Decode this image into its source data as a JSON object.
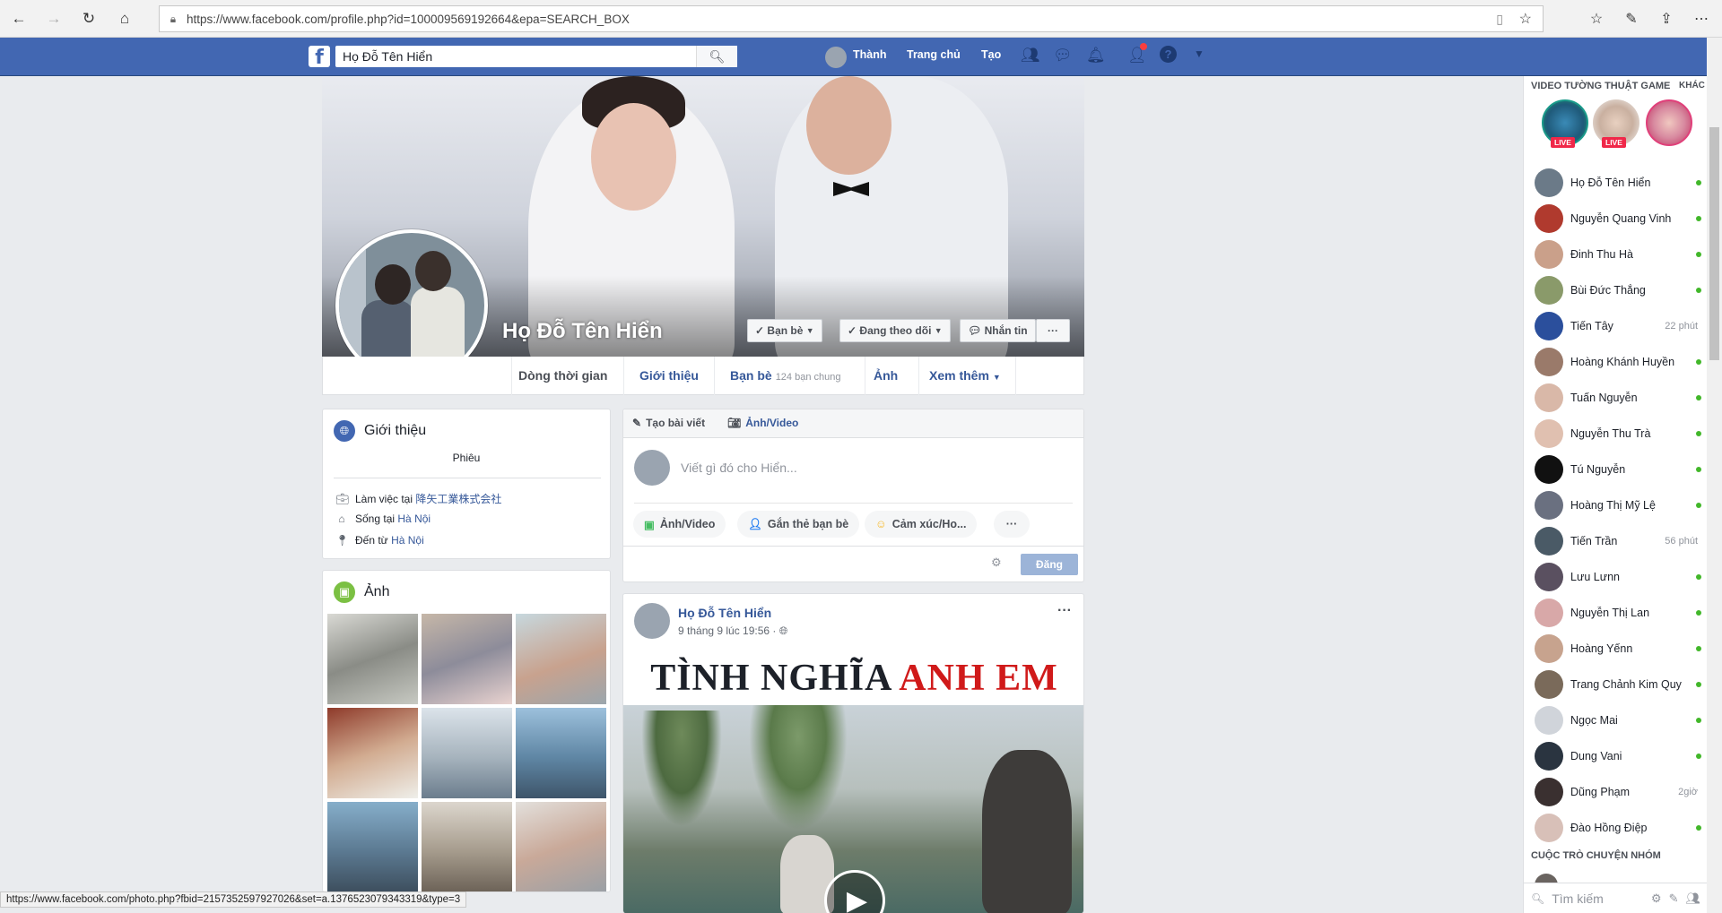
{
  "browser": {
    "url": "https://www.facebook.com/profile.php?id=100009569192664&epa=SEARCH_BOX"
  },
  "fb": {
    "search_value": "Họ Đỗ Tên Hiển",
    "nav_user": "Thành",
    "nav_home": "Trang chủ",
    "nav_create": "Tạo"
  },
  "profile": {
    "name": "Họ Đỗ Tên Hiển",
    "btn_friends": "Bạn bè",
    "btn_following": "Đang theo dõi",
    "btn_message": "Nhắn tin",
    "btn_more": "···",
    "tabs": [
      {
        "label": "Dòng thời gian"
      },
      {
        "label": "Giới thiệu"
      },
      {
        "label": "Bạn bè",
        "sub": "124 bạn chung"
      },
      {
        "label": "Ảnh"
      },
      {
        "label": "Xem thêm"
      }
    ]
  },
  "intro": {
    "title": "Giới thiệu",
    "bio": "Phiêu",
    "work_prefix": "Làm việc tại",
    "work_link": "降矢工業株式会社",
    "live_prefix": "Sống tại",
    "live_link": "Hà Nội",
    "from_prefix": "Đến từ",
    "from_link": "Hà Nội"
  },
  "photos": {
    "title": "Ảnh"
  },
  "composer": {
    "tab_create": "Tạo bài viết",
    "tab_media": "Ảnh/Video",
    "placeholder": "Viết gì đó cho Hiển...",
    "pill_media": "Ảnh/Video",
    "pill_tag": "Gắn thẻ bạn bè",
    "pill_feeling": "Cảm xúc/Ho...",
    "pill_more": "···",
    "post_button": "Đăng"
  },
  "post": {
    "author": "Họ Đỗ Tên Hiển",
    "time": "9 tháng 9 lúc 19:56 ·",
    "menu": "···",
    "video_title_black": "TÌNH NGHĨA",
    "video_title_red": "ANH EM"
  },
  "sidebar": {
    "video_header": "VIDEO TƯỜNG THUẬT GAME",
    "video_more": "KHÁC",
    "live_label": "LIVE",
    "group_header": "CUỘC TRÒ CHUYỆN NHÓM",
    "search_placeholder": "Tìm kiếm",
    "contacts": [
      {
        "name": "Họ Đỗ Tên Hiển",
        "status": "",
        "color": "#6b7a88"
      },
      {
        "name": "Nguyễn Quang Vinh",
        "status": "",
        "color": "#b03a2e"
      },
      {
        "name": "Đinh Thu Hà",
        "status": "",
        "color": "#caa08a"
      },
      {
        "name": "Bùi Đức Thắng",
        "status": "",
        "color": "#8a9a6a"
      },
      {
        "name": "Tiến Tây",
        "status": "22 phút",
        "color": "#2b4f9c"
      },
      {
        "name": "Hoàng Khánh Huyền",
        "status": "",
        "color": "#9a7a6a"
      },
      {
        "name": "Tuấn Nguyễn",
        "status": "",
        "color": "#d9b8a8"
      },
      {
        "name": "Nguyễn Thu Trà",
        "status": "",
        "color": "#e0c0b0"
      },
      {
        "name": "Tú Nguyễn",
        "status": "",
        "color": "#111111"
      },
      {
        "name": "Hoàng Thị Mỹ Lệ",
        "status": "",
        "color": "#6a7080"
      },
      {
        "name": "Tiến Trần",
        "status": "56 phút",
        "color": "#4a5a66"
      },
      {
        "name": "Lưu Lưnn",
        "status": "",
        "color": "#5a5060"
      },
      {
        "name": "Nguyễn Thị Lan",
        "status": "",
        "color": "#d8a8a8"
      },
      {
        "name": "Hoàng Yếnn",
        "status": "",
        "color": "#c7a38e"
      },
      {
        "name": "Trang Chảnh Kim Quy",
        "status": "",
        "color": "#7a6a5a"
      },
      {
        "name": "Ngọc Mai",
        "status": "",
        "color": "#d0d4da"
      },
      {
        "name": "Dung Vani",
        "status": "",
        "color": "#2a3440"
      },
      {
        "name": "Dũng Phạm",
        "status": "2giờ",
        "color": "#3a3030"
      },
      {
        "name": "Đào Hồng Điệp",
        "status": "",
        "color": "#d8c0b8"
      }
    ]
  },
  "statusbar": {
    "text": "https://www.facebook.com/photo.php?fbid=2157352597927026&set=a.1376523079343319&type=3"
  },
  "colors": {
    "fb_blue": "#4267b2",
    "link": "#365899",
    "online": "#42b72a",
    "live_red": "#f02849"
  }
}
